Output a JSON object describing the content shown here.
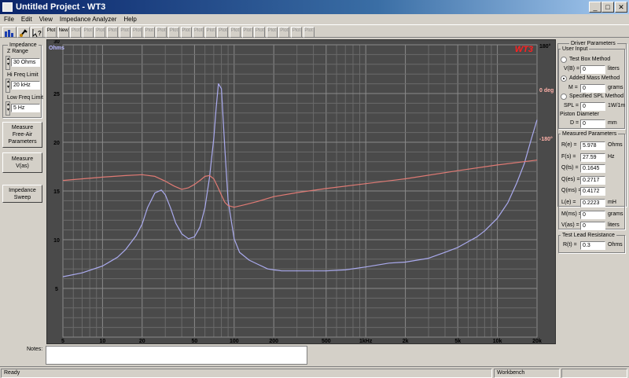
{
  "window": {
    "title": "Untitled Project - WT3",
    "min": "_",
    "max": "□",
    "close": "✕"
  },
  "menu": [
    "File",
    "Edit",
    "View",
    "Impedance Analyzer",
    "Help"
  ],
  "toolbar": {
    "plot_labels": [
      "Plot",
      "Plot",
      "Plot",
      "Plot",
      "Plot",
      "Plot",
      "Plot",
      "Plot",
      "Plot",
      "Plot",
      "Plot",
      "Plot",
      "Plot",
      "Plot",
      "Plot",
      "Plot",
      "Plot",
      "Plot",
      "Plot",
      "Plot",
      "Plot"
    ],
    "new_label": "New"
  },
  "left": {
    "impedance_title": "Impedance",
    "z_range_label": "Z Range",
    "z_range_value": "30 Ohms",
    "hi_freq_label": "Hi Freq Limit",
    "hi_freq_value": "20 kHz",
    "low_freq_label": "Low Freq Limit",
    "low_freq_value": "5 Hz",
    "btn_measure_free_air": "Measure Free-Air Parameters",
    "btn_measure_vas": "Measure V(as)",
    "btn_impedance_sweep": "Impedance Sweep"
  },
  "chart": {
    "wt3_badge": "WT3",
    "ohms_label": "Ohms",
    "top_left_value": "30",
    "y_ticks": [
      "25",
      "20",
      "15",
      "10",
      "5"
    ],
    "x_ticks": [
      "5",
      "10",
      "20",
      "50",
      "100",
      "200",
      "500",
      "1kHz",
      "2k",
      "5k",
      "10k",
      "20k"
    ],
    "phase_ticks": [
      "180°",
      "0 deg",
      "-180°"
    ],
    "colors": {
      "impedance": "#aaaaee",
      "phase": "#e07a74",
      "background": "#4a4a4a",
      "grid": "#6a6a6a",
      "badge": "#ff2020",
      "phase_tick": "#ffb0a8"
    }
  },
  "chart_data": {
    "type": "line",
    "x_scale": "log",
    "xlim": [
      5,
      20000
    ],
    "ylim": [
      0,
      30
    ],
    "y2lim": [
      -180,
      180
    ],
    "series": [
      {
        "axis": "left",
        "x": [
          5,
          7,
          10,
          13,
          15,
          18,
          20,
          22,
          25,
          28,
          30,
          33,
          36,
          40,
          45,
          50,
          55,
          60,
          65,
          70,
          73,
          76,
          80,
          85,
          90,
          100,
          110,
          130,
          150,
          180,
          200,
          230,
          260,
          300,
          400,
          500,
          700,
          1000,
          1500,
          2000,
          3000,
          4000,
          5000,
          6000,
          7000,
          8000,
          10000,
          12000,
          14000,
          16000,
          18000,
          20000
        ],
        "y": [
          6.2,
          6.6,
          7.3,
          8.2,
          9,
          10.4,
          11.6,
          13.3,
          14.8,
          15.1,
          14.6,
          13.2,
          11.7,
          10.6,
          10.1,
          10.3,
          11.3,
          13.3,
          16.4,
          20.4,
          23.5,
          26.0,
          25.5,
          19.3,
          14.0,
          10.1,
          8.7,
          7.9,
          7.5,
          7.0,
          6.9,
          6.8,
          6.8,
          6.8,
          6.8,
          6.8,
          6.9,
          7.2,
          7.6,
          7.7,
          8.1,
          8.7,
          9.2,
          9.8,
          10.3,
          10.9,
          12.2,
          13.8,
          15.8,
          17.8,
          20.2,
          22.3
        ]
      },
      {
        "axis": "right",
        "x": [
          5,
          10,
          15,
          20,
          25,
          30,
          35,
          40,
          45,
          50,
          55,
          60,
          65,
          70,
          75,
          80,
          85,
          90,
          100,
          120,
          150,
          200,
          300,
          500,
          1000,
          2000,
          5000,
          10000,
          20000
        ],
        "y": [
          13,
          17,
          19,
          20,
          18,
          12,
          6,
          2,
          4,
          8,
          13,
          18,
          19,
          15,
          5,
          -5,
          -14,
          -18,
          -20,
          -17,
          -13,
          -7,
          -2,
          3,
          9,
          15,
          25,
          32,
          38
        ]
      }
    ]
  },
  "right": {
    "driver_params_title": "Driver Parameters",
    "user_input_title": "User Input",
    "test_box_label": "Test Box Method",
    "vb_label": "V(B) =",
    "vb_value": "0",
    "vb_unit": "liters",
    "added_mass_label": "Added Mass Method",
    "m_label": "M =",
    "m_value": "0",
    "m_unit": "grams",
    "spl_method_label": "Specified SPL Method",
    "spl_label": "SPL =",
    "spl_value": "0",
    "spl_unit": "1W/1m",
    "piston_label": "Piston Diameter",
    "d_label": "D =",
    "d_value": "0",
    "d_unit": "mm",
    "measured_title": "Measured Parameters",
    "params": [
      {
        "label": "R(e) =",
        "value": "5.978",
        "unit": "Ohms"
      },
      {
        "label": "F(s) =",
        "value": "27.59",
        "unit": "Hz"
      },
      {
        "label": "Q(ts) =",
        "value": "0.1645",
        "unit": ""
      },
      {
        "label": "Q(es) =",
        "value": "0.2717",
        "unit": ""
      },
      {
        "label": "Q(ms) =",
        "value": "0.4172",
        "unit": ""
      },
      {
        "label": "L(e) =",
        "value": "0.2223",
        "unit": "mH"
      },
      {
        "label": "M(ms) =",
        "value": "0",
        "unit": "grams"
      },
      {
        "label": "V(as) =",
        "value": "0",
        "unit": "liters"
      }
    ],
    "test_lead_title": "Test Lead Resistance",
    "rt_label": "R(t) =",
    "rt_value": "0.3",
    "rt_unit": "Ohms"
  },
  "notes_label": "Notes:",
  "status": {
    "ready": "Ready",
    "workbench": "Workbench"
  }
}
